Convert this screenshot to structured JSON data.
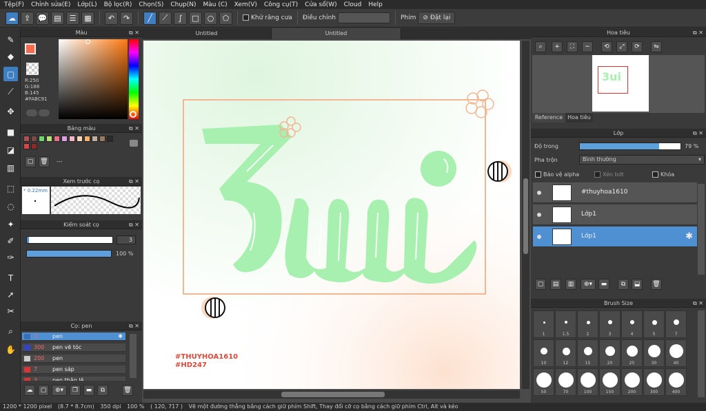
{
  "menu": [
    "Tệp(F)",
    "Chỉnh sửa(E)",
    "Lớp(L)",
    "Bộ lọc(R)",
    "Chọn(S)",
    "Chụp(N)",
    "Màu (C)",
    "Xem(V)",
    "Công cụ(T)",
    "Cửa sổ(W)",
    "Cloud",
    "Help"
  ],
  "toolbar": {
    "antialias_label": "Khử răng cưa",
    "adjust_label": "Điều chỉnh",
    "key_label": "Phím",
    "reset_label": "Đặt lại"
  },
  "panels": {
    "color": "Màu",
    "palette": "Bảng màu",
    "brush_preview": "Xem trước cọ",
    "brush_control": "Kiểm soát cọ",
    "brush": "Cọ: pen",
    "navigator": "Hoa tiêu",
    "layer": "Lớp",
    "brush_size": "Brush Size"
  },
  "color": {
    "r": "R:250",
    "g": "G:188",
    "b": "B:145",
    "hex": "#FABC91",
    "current": "#fa6b4e"
  },
  "palette": {
    "colors": [
      "#b05050",
      "#7a4b4b",
      "#6fd66f",
      "#b7e27a",
      "#e86e8a",
      "#e0a0e0",
      "#f5b5c5",
      "#f7d5b5",
      "#fbb06a",
      "#c0b0a0",
      "#9a7a5a",
      "#2a2a2a",
      "#d74545",
      "#8b2a2a"
    ],
    "label": "---"
  },
  "brush_preview": {
    "size": "* 0.22mm"
  },
  "brush_control": {
    "size_value": "3",
    "opacity_value": "100 %",
    "opacity": 1.0
  },
  "brushes": [
    {
      "size": "3",
      "name": "pen",
      "color": "#3a6fb5",
      "selected": true
    },
    {
      "size": "300",
      "name": "pen vẽ tóc",
      "color": "#3344cc",
      "selected": false
    },
    {
      "size": "200",
      "name": "pen",
      "color": "#cccccc",
      "selected": false
    },
    {
      "size": "7",
      "name": "pen sáp",
      "color": "#dd3333",
      "selected": false
    },
    {
      "size": "3",
      "name": "pen thân lệ",
      "color": "#dd3333",
      "selected": false
    }
  ],
  "tabs": [
    "Untitled",
    "Untitled"
  ],
  "navigator": {
    "tab_reference": "Reference",
    "tab_navigator": "Hoa tiêu"
  },
  "layer": {
    "opacity_label": "Độ trong",
    "opacity_value": "79 %",
    "opacity": 0.79,
    "blend_label": "Pha trộn",
    "blend_value": "Bình thường",
    "protect_alpha": "Bảo vệ alpha",
    "clip": "Xén bớt",
    "lock": "Khóa",
    "layers": [
      {
        "name": "#thuyhoa1610",
        "selected": false
      },
      {
        "name": "Lớp1",
        "selected": false
      },
      {
        "name": "Lớp1",
        "selected": true
      }
    ]
  },
  "brush_sizes": [
    "1",
    "1.5",
    "2",
    "3",
    "4",
    "5",
    "7",
    "10",
    "12",
    "15",
    "20",
    "25",
    "30",
    "40",
    "50",
    "70",
    "100",
    "150",
    "200",
    "300",
    "400"
  ],
  "canvas": {
    "signature_1": "#THUYHOA1610",
    "signature_2": "#HD247"
  },
  "status": {
    "size": "1200 * 1200 pixel",
    "cm": "(8.7 * 8.7cm)",
    "dpi": "350 dpi",
    "zoom": "100 %",
    "coords": "( 120, 717 )",
    "hint": "Vẽ một đường thẳng bằng cách giữ phím Shift, Thay đổi cỡ cọ bằng cách giữ phím Ctrl, Alt và kéo"
  }
}
